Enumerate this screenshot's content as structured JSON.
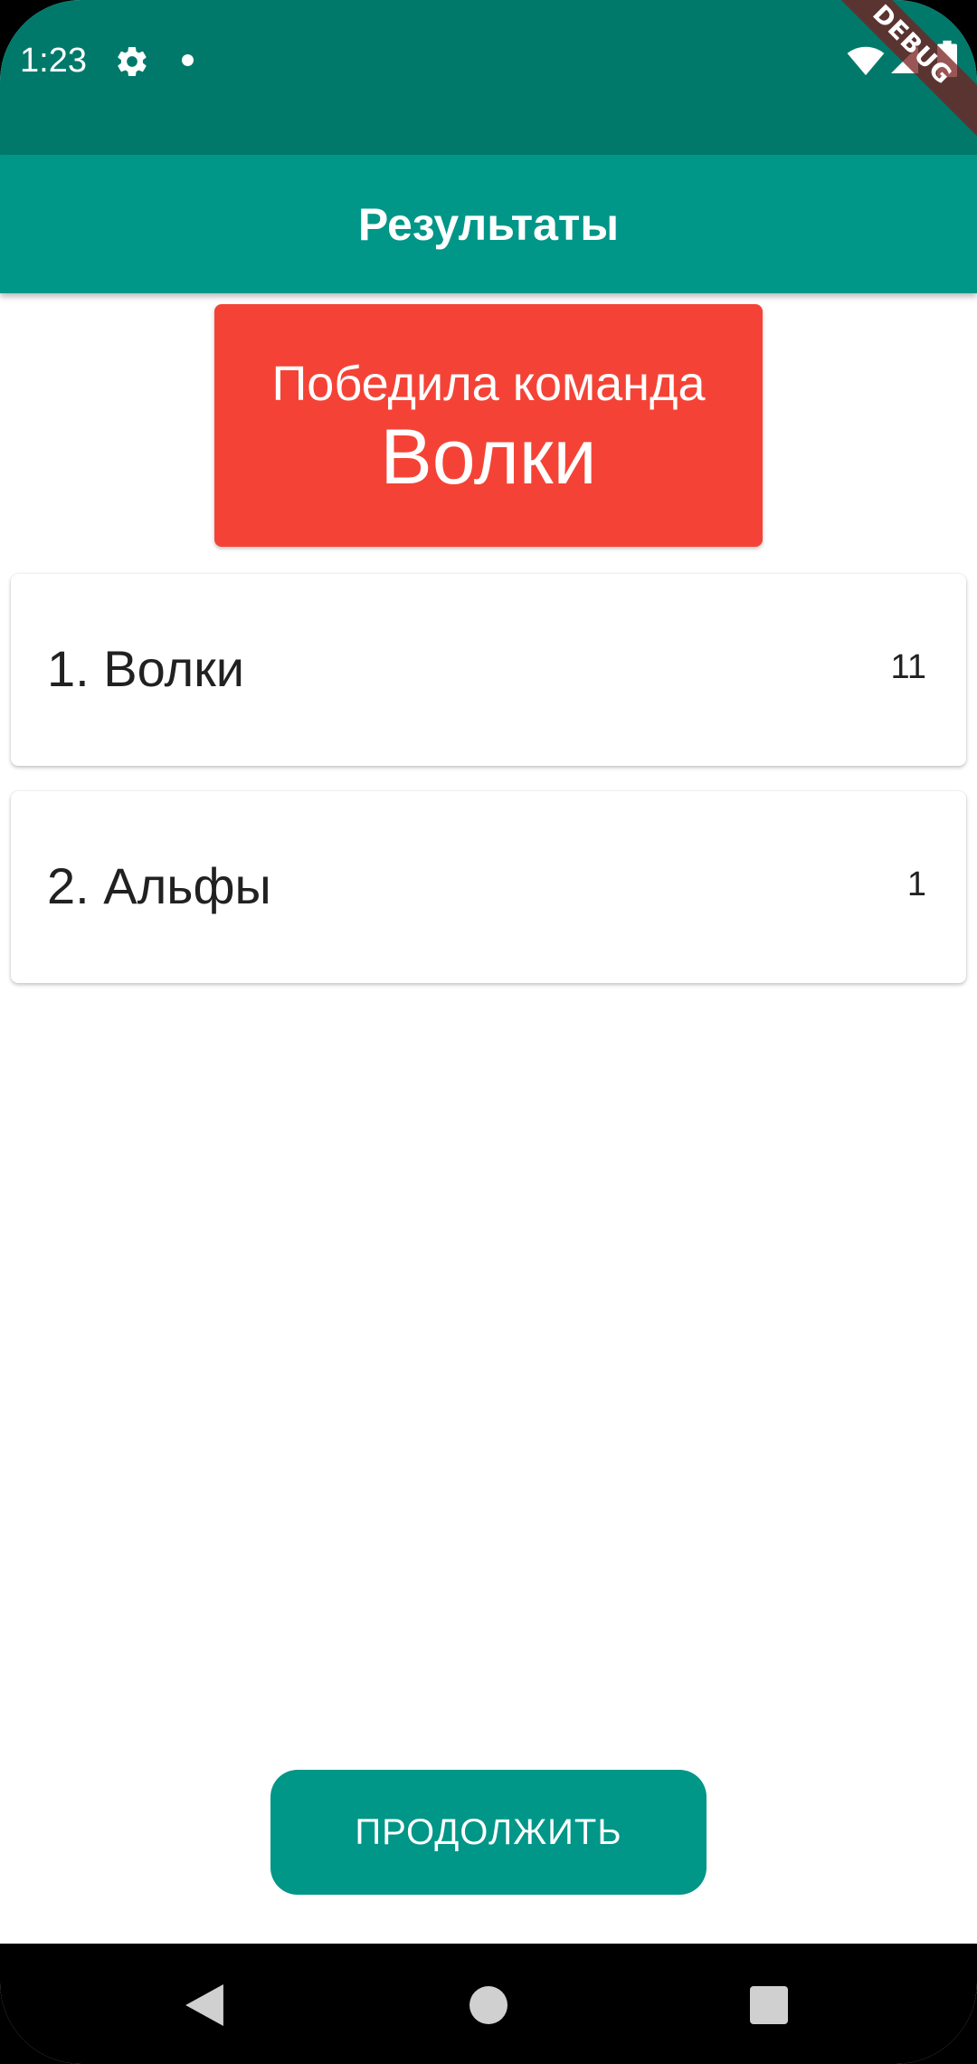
{
  "status_bar": {
    "time": "1:23",
    "icons": [
      "gear-icon",
      "notification-dot-icon",
      "wifi-icon",
      "signal-icon",
      "battery-icon"
    ],
    "debug_label": "DEBUG"
  },
  "app_bar": {
    "title": "Результаты"
  },
  "winner": {
    "caption": "Победила команда",
    "team": "Волки"
  },
  "results": [
    {
      "name": "1. Волки",
      "score": "11"
    },
    {
      "name": "2. Альфы",
      "score": "1"
    }
  ],
  "continue_button": {
    "label": "ПРОДОЛЖИТЬ"
  },
  "nav_bar": {
    "icons": [
      "back-icon",
      "home-icon",
      "recents-icon"
    ]
  },
  "colors": {
    "status_bar": "#00796b",
    "app_bar": "#009688",
    "winner_banner": "#f44336",
    "button": "#009688"
  }
}
